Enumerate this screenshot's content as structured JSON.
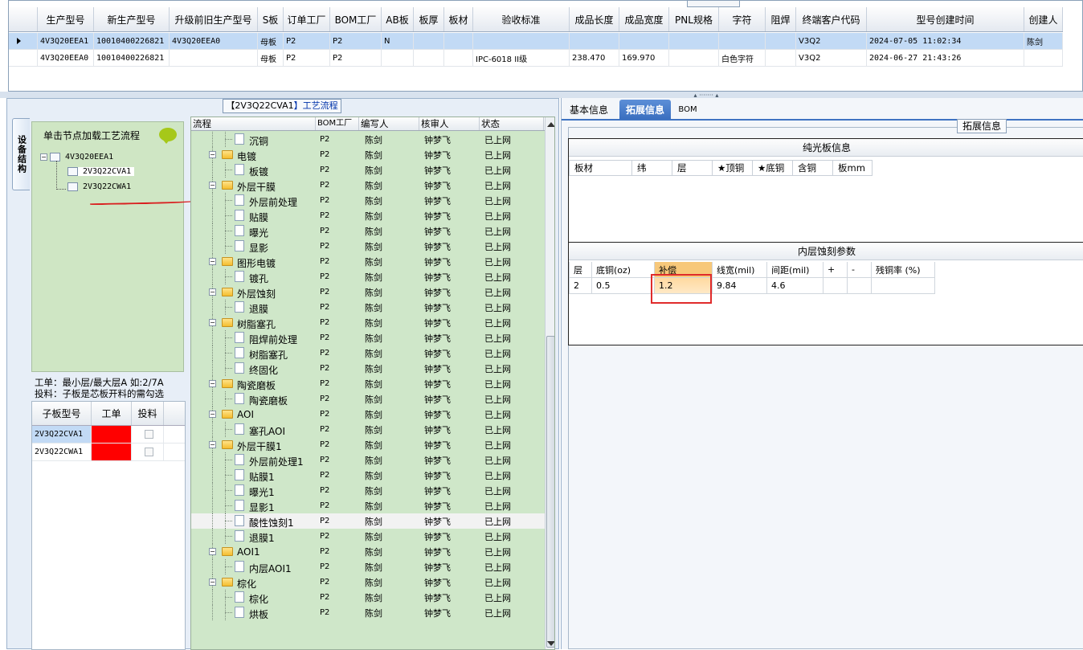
{
  "top_grid": {
    "headers": [
      "生产型号",
      "新生产型号",
      "升级前旧生产型号",
      "S板",
      "订单工厂",
      "BOM工厂",
      "AB板",
      "板厚",
      "板材",
      "验收标准",
      "成品长度",
      "成品宽度",
      "PNL规格",
      "字符",
      "阻焊",
      "终端客户代码",
      "型号创建时间",
      "创建人"
    ],
    "rows": [
      {
        "selected": true,
        "cells": [
          "4V3Q20EEA1",
          "10010400226821",
          "4V3Q20EEA0",
          "母板",
          "P2",
          "P2",
          "N",
          "",
          "",
          "",
          "",
          "",
          "",
          "",
          "",
          "V3Q2",
          "2024-07-05 11:02:34",
          "陈剑"
        ]
      },
      {
        "selected": false,
        "cells": [
          "4V3Q20EEA0",
          "10010400226821",
          "",
          "母板",
          "P2",
          "P2",
          "",
          "",
          "",
          "IPC-6018 II级",
          "238.470",
          "169.970",
          "",
          "白色字符",
          "",
          "V3Q2",
          "2024-06-27 21:43:26",
          ""
        ]
      }
    ]
  },
  "left_tab": "设备结构",
  "process_title_prefix": "【",
  "process_title_model": "2V3Q22CVA1",
  "process_title_suffix": "】工艺流程",
  "tree": {
    "hint": "单击节点加载工艺流程",
    "root": "4V3Q20EEA1",
    "children": [
      "2V3Q22CVA1",
      "2V3Q22CWA1"
    ]
  },
  "info": {
    "line1": "工单：最小层/最大层A 如:2/7A",
    "line2": "投料：子板是芯板开料的需勾选"
  },
  "sub_grid": {
    "headers": [
      "子板型号",
      "工单",
      "投料"
    ],
    "rows": [
      {
        "model": "2V3Q22CVA1"
      },
      {
        "model": "2V3Q22CWA1"
      }
    ]
  },
  "process_grid": {
    "headers": [
      "流程",
      "BOM工厂",
      "编写人",
      "核审人",
      "状态"
    ],
    "rows": [
      {
        "name": "沉铜",
        "level": 1,
        "bom": "P2",
        "writer": "陈剑",
        "reviewer": "钟梦飞",
        "status": "已上网"
      },
      {
        "name": "电镀",
        "level": 0,
        "bom": "P2",
        "writer": "陈剑",
        "reviewer": "钟梦飞",
        "status": "已上网"
      },
      {
        "name": "板镀",
        "level": 1,
        "bom": "P2",
        "writer": "陈剑",
        "reviewer": "钟梦飞",
        "status": "已上网"
      },
      {
        "name": "外层干膜",
        "level": 0,
        "bom": "P2",
        "writer": "陈剑",
        "reviewer": "钟梦飞",
        "status": "已上网"
      },
      {
        "name": "外层前处理",
        "level": 1,
        "bom": "P2",
        "writer": "陈剑",
        "reviewer": "钟梦飞",
        "status": "已上网"
      },
      {
        "name": "贴膜",
        "level": 1,
        "bom": "P2",
        "writer": "陈剑",
        "reviewer": "钟梦飞",
        "status": "已上网"
      },
      {
        "name": "曝光",
        "level": 1,
        "bom": "P2",
        "writer": "陈剑",
        "reviewer": "钟梦飞",
        "status": "已上网"
      },
      {
        "name": "显影",
        "level": 1,
        "bom": "P2",
        "writer": "陈剑",
        "reviewer": "钟梦飞",
        "status": "已上网"
      },
      {
        "name": "图形电镀",
        "level": 0,
        "bom": "P2",
        "writer": "陈剑",
        "reviewer": "钟梦飞",
        "status": "已上网"
      },
      {
        "name": "镀孔",
        "level": 1,
        "bom": "P2",
        "writer": "陈剑",
        "reviewer": "钟梦飞",
        "status": "已上网"
      },
      {
        "name": "外层蚀刻",
        "level": 0,
        "bom": "P2",
        "writer": "陈剑",
        "reviewer": "钟梦飞",
        "status": "已上网"
      },
      {
        "name": "退膜",
        "level": 1,
        "bom": "P2",
        "writer": "陈剑",
        "reviewer": "钟梦飞",
        "status": "已上网"
      },
      {
        "name": "树脂塞孔",
        "level": 0,
        "bom": "P2",
        "writer": "陈剑",
        "reviewer": "钟梦飞",
        "status": "已上网"
      },
      {
        "name": "阻焊前处理",
        "level": 1,
        "bom": "P2",
        "writer": "陈剑",
        "reviewer": "钟梦飞",
        "status": "已上网"
      },
      {
        "name": "树脂塞孔",
        "level": 1,
        "bom": "P2",
        "writer": "陈剑",
        "reviewer": "钟梦飞",
        "status": "已上网"
      },
      {
        "name": "终固化",
        "level": 1,
        "bom": "P2",
        "writer": "陈剑",
        "reviewer": "钟梦飞",
        "status": "已上网"
      },
      {
        "name": "陶瓷磨板",
        "level": 0,
        "bom": "P2",
        "writer": "陈剑",
        "reviewer": "钟梦飞",
        "status": "已上网"
      },
      {
        "name": "陶瓷磨板",
        "level": 1,
        "bom": "P2",
        "writer": "陈剑",
        "reviewer": "钟梦飞",
        "status": "已上网"
      },
      {
        "name": "AOI",
        "level": 0,
        "bom": "P2",
        "writer": "陈剑",
        "reviewer": "钟梦飞",
        "status": "已上网"
      },
      {
        "name": "塞孔AOI",
        "level": 1,
        "bom": "P2",
        "writer": "陈剑",
        "reviewer": "钟梦飞",
        "status": "已上网"
      },
      {
        "name": "外层干膜1",
        "level": 0,
        "bom": "P2",
        "writer": "陈剑",
        "reviewer": "钟梦飞",
        "status": "已上网"
      },
      {
        "name": "外层前处理1",
        "level": 1,
        "bom": "P2",
        "writer": "陈剑",
        "reviewer": "钟梦飞",
        "status": "已上网"
      },
      {
        "name": "贴膜1",
        "level": 1,
        "bom": "P2",
        "writer": "陈剑",
        "reviewer": "钟梦飞",
        "status": "已上网"
      },
      {
        "name": "曝光1",
        "level": 1,
        "bom": "P2",
        "writer": "陈剑",
        "reviewer": "钟梦飞",
        "status": "已上网"
      },
      {
        "name": "显影1",
        "level": 1,
        "bom": "P2",
        "writer": "陈剑",
        "reviewer": "钟梦飞",
        "status": "已上网"
      },
      {
        "name": "酸性蚀刻1",
        "level": 1,
        "bom": "P2",
        "writer": "陈剑",
        "reviewer": "钟梦飞",
        "status": "已上网",
        "selected": true
      },
      {
        "name": "退膜1",
        "level": 1,
        "bom": "P2",
        "writer": "陈剑",
        "reviewer": "钟梦飞",
        "status": "已上网"
      },
      {
        "name": "AOI1",
        "level": 0,
        "bom": "P2",
        "writer": "陈剑",
        "reviewer": "钟梦飞",
        "status": "已上网"
      },
      {
        "name": "内层AOI1",
        "level": 1,
        "bom": "P2",
        "writer": "陈剑",
        "reviewer": "钟梦飞",
        "status": "已上网"
      },
      {
        "name": "棕化",
        "level": 0,
        "bom": "P2",
        "writer": "陈剑",
        "reviewer": "钟梦飞",
        "status": "已上网"
      },
      {
        "name": "棕化",
        "level": 1,
        "bom": "P2",
        "writer": "陈剑",
        "reviewer": "钟梦飞",
        "status": "已上网"
      },
      {
        "name": "烘板",
        "level": 1,
        "bom": "P2",
        "writer": "陈剑",
        "reviewer": "钟梦飞",
        "status": "已上网"
      }
    ]
  },
  "right_tabs": [
    "基本信息",
    "拓展信息",
    "BOM"
  ],
  "ext_legend": "拓展信息",
  "pure_section": {
    "title": "纯光板信息",
    "headers": [
      "板材",
      "纬",
      "层",
      "★顶铜",
      "★底铜",
      "含铜",
      "板mm"
    ]
  },
  "inner_section": {
    "title": "内层蚀刻参数",
    "headers": [
      "层",
      "底铜(oz)",
      "补偿",
      "线宽(mil)",
      "间距(mil)",
      "+",
      "-",
      "残铜率 (%)"
    ],
    "rows": [
      [
        "2",
        "0.5",
        "1.2",
        "9.84",
        "4.6",
        "",
        "",
        ""
      ]
    ]
  },
  "colors": {
    "accent": "#3f73c2",
    "tree_bg": "#cfe6c4",
    "selected_row": "#c2daf5",
    "highlight": "#e02b2b"
  }
}
